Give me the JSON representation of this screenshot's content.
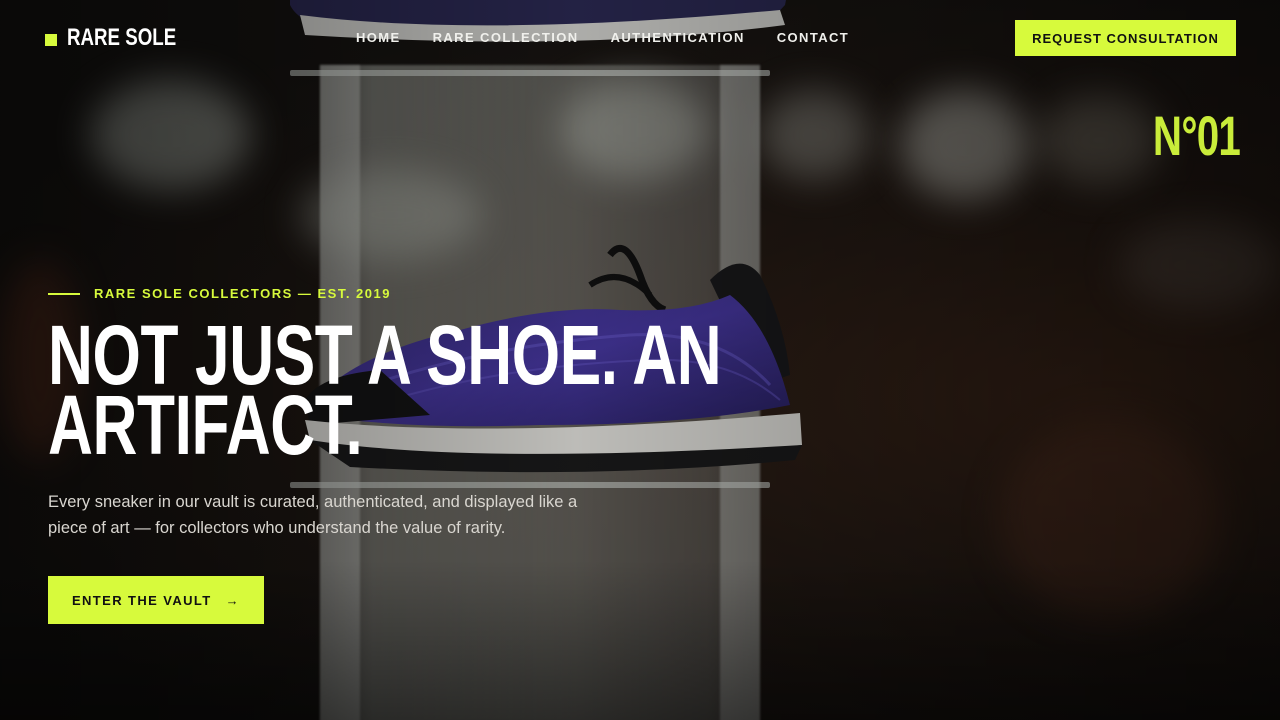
{
  "brand": {
    "name": "RARE SOLE"
  },
  "nav": {
    "items": [
      {
        "label": "HOME"
      },
      {
        "label": "RARE COLLECTION"
      },
      {
        "label": "AUTHENTICATION"
      },
      {
        "label": "CONTACT"
      }
    ],
    "cta_label": "REQUEST CONSULTATION"
  },
  "hero": {
    "number": "N°01",
    "eyebrow": "RARE SOLE COLLECTORS — EST. 2019",
    "headline_line1": "NOT JUST A SHOE. AN",
    "headline_line2": "ARTIFACT.",
    "description": "Every sneaker in our vault is curated, authenticated, and displayed like a piece of art — for collectors who understand the value of rarity.",
    "cta_label": "ENTER THE VAULT",
    "cta_icon": "arrow-right-icon",
    "cta_arrow": "→"
  },
  "colors": {
    "accent": "#d7fa3c",
    "number": "#c9ec3a",
    "background": "#1a1816"
  }
}
